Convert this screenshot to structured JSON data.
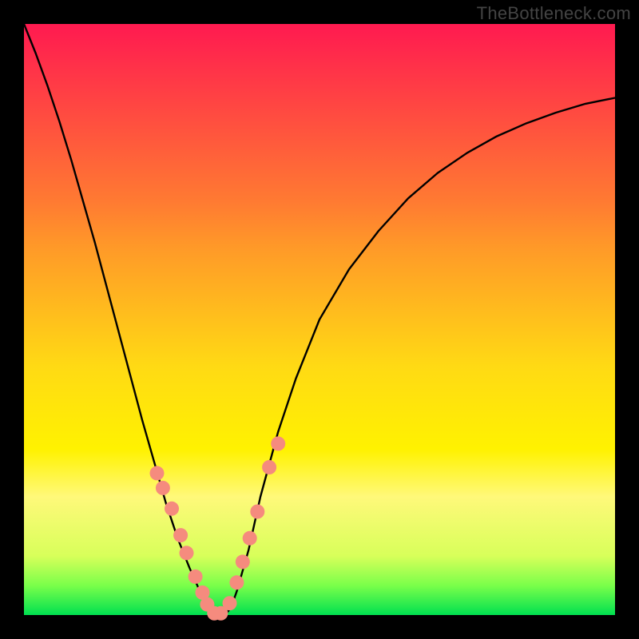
{
  "watermark": "TheBottleneck.com",
  "chart_data": {
    "type": "line",
    "title": "",
    "xlabel": "",
    "ylabel": "",
    "ylim": [
      0,
      100
    ],
    "series": [
      {
        "name": "curve",
        "x": [
          0.0,
          0.02,
          0.04,
          0.06,
          0.08,
          0.1,
          0.12,
          0.14,
          0.16,
          0.18,
          0.2,
          0.22,
          0.24,
          0.26,
          0.28,
          0.3,
          0.31,
          0.32,
          0.33,
          0.34,
          0.35,
          0.36,
          0.38,
          0.4,
          0.43,
          0.46,
          0.5,
          0.55,
          0.6,
          0.65,
          0.7,
          0.75,
          0.8,
          0.85,
          0.9,
          0.95,
          1.0
        ],
        "y": [
          100.0,
          95.0,
          89.5,
          83.5,
          77.0,
          70.0,
          63.0,
          55.5,
          48.0,
          40.5,
          33.0,
          26.0,
          19.0,
          13.0,
          8.0,
          3.5,
          1.2,
          0.0,
          0.0,
          0.0,
          1.2,
          4.0,
          11.0,
          20.0,
          31.0,
          40.0,
          50.0,
          58.5,
          65.0,
          70.5,
          74.8,
          78.2,
          81.0,
          83.2,
          85.0,
          86.5,
          87.5
        ]
      }
    ],
    "markers": {
      "name": "dots",
      "color": "#f58b7e",
      "x": [
        0.225,
        0.235,
        0.25,
        0.265,
        0.275,
        0.29,
        0.302,
        0.31,
        0.322,
        0.333,
        0.348,
        0.36,
        0.37,
        0.382,
        0.395,
        0.415,
        0.43
      ],
      "y": [
        24.0,
        21.5,
        18.0,
        13.5,
        10.5,
        6.5,
        3.8,
        1.8,
        0.3,
        0.3,
        2.0,
        5.5,
        9.0,
        13.0,
        17.5,
        25.0,
        29.0
      ]
    }
  }
}
